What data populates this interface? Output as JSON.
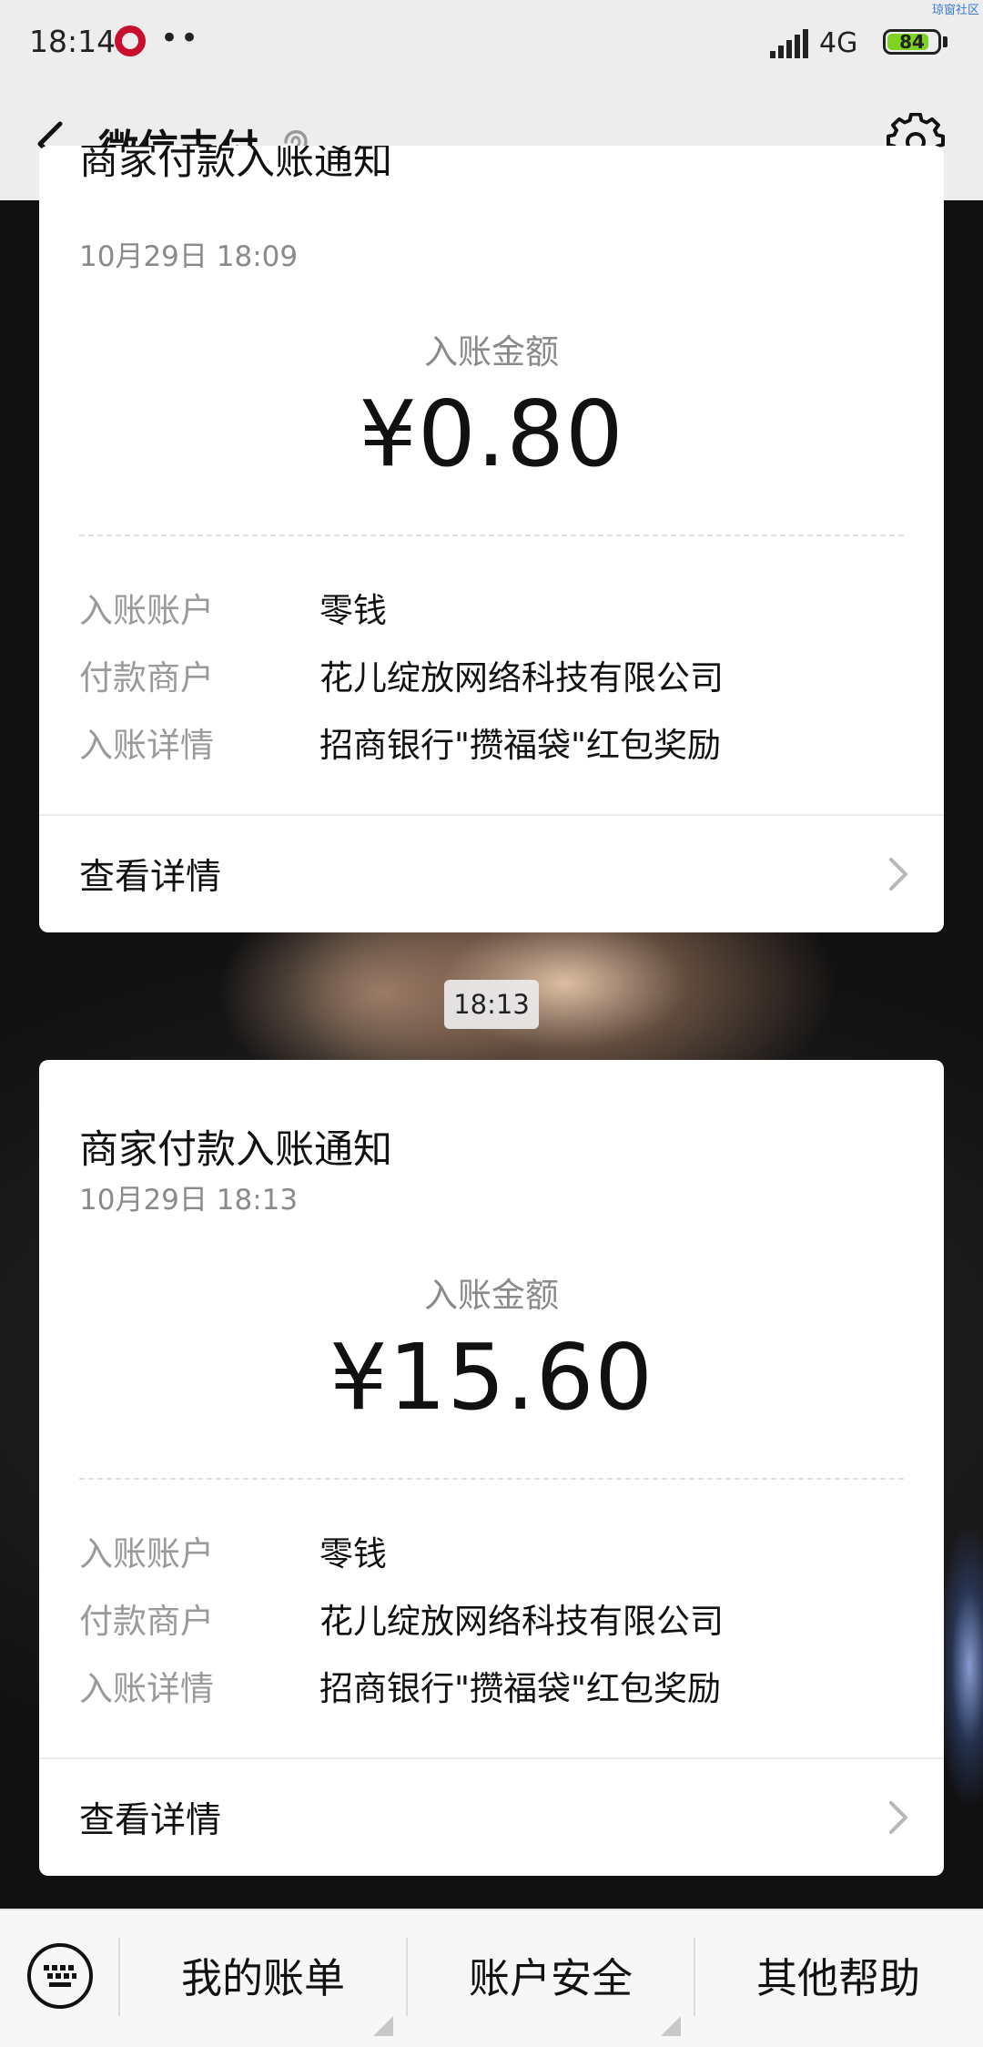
{
  "status_bar": {
    "time": "18:14",
    "dots": "••",
    "network": "4G",
    "battery": "84",
    "battery_level": 0.84,
    "watermark": "琼窗社区"
  },
  "header": {
    "title": "微信支付",
    "back_icon": "back-arrow-icon",
    "settings_icon": "gear-icon",
    "ear_icon": "ear-icon"
  },
  "messages": [
    {
      "title": "商家付款入账通知",
      "date": "10月29日  18:09",
      "amount_label": "入账金额",
      "amount": "¥0.80",
      "rows": [
        {
          "label": "入账账户",
          "value": "零钱"
        },
        {
          "label": "付款商户",
          "value": "花儿绽放网络科技有限公司"
        },
        {
          "label": "入账详情",
          "value": "招商银行\"攒福袋\"红包奖励"
        }
      ],
      "detail_link": "查看详情"
    },
    {
      "title": "商家付款入账通知",
      "date": "10月29日  18:13",
      "amount_label": "入账金额",
      "amount": "¥15.60",
      "rows": [
        {
          "label": "入账账户",
          "value": "零钱"
        },
        {
          "label": "付款商户",
          "value": "花儿绽放网络科技有限公司"
        },
        {
          "label": "入账详情",
          "value": "招商银行\"攒福袋\"红包奖励"
        }
      ],
      "detail_link": "查看详情"
    }
  ],
  "time_separator": "18:13",
  "bottom_menu": {
    "keyboard_icon": "keyboard-icon",
    "items": [
      "我的账单",
      "账户安全",
      "其他帮助"
    ]
  }
}
